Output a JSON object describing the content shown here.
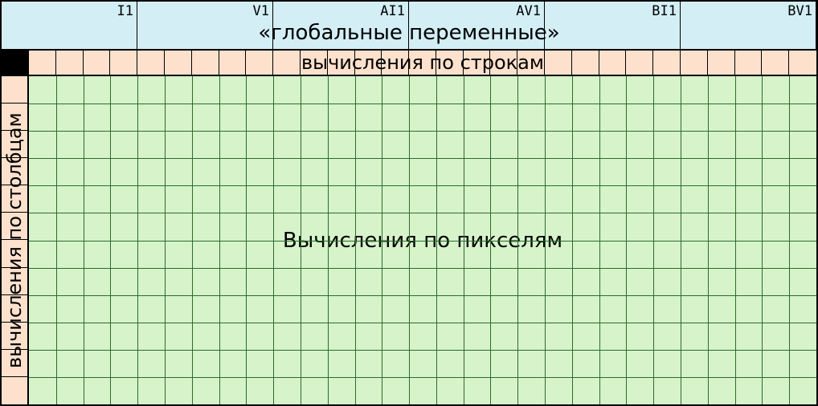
{
  "globals": {
    "title": "«глобальные переменные»",
    "cells": [
      "I1",
      "V1",
      "AI1",
      "AV1",
      "BI1",
      "BV1"
    ]
  },
  "row_calc_title": "вычисления по строкам",
  "col_calc_title": "вычисления по столбцам",
  "pixel_title": "Вычисления по пикселям",
  "grid": {
    "cols": 29,
    "rows": 12
  },
  "colors": {
    "globals_bg": "#d3eef5",
    "calc_bg": "#fde1cd",
    "grid_bg": "#d6f3ca",
    "grid_line": "#2c6b2f"
  }
}
